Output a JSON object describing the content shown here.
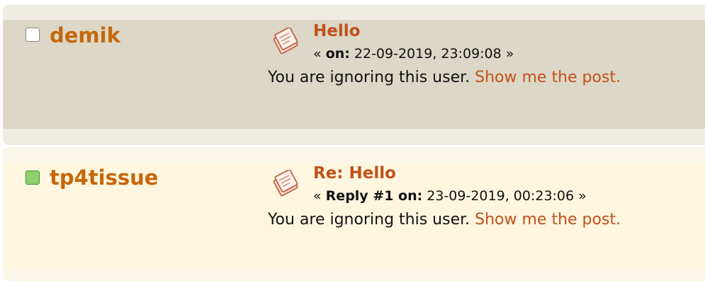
{
  "posts": [
    {
      "poster": "demik",
      "subject": "Hello",
      "meta_open": "« ",
      "meta_label": "on:",
      "meta_date": " 22-09-2019, 23:09:08 »",
      "notice": "You are ignoring this user. ",
      "show_link": "Show me the post.",
      "status": "offline"
    },
    {
      "poster": "tp4tissue",
      "subject": "Re: Hello",
      "meta_open": "« ",
      "meta_label": "Reply #1 on:",
      "meta_date": " 23-09-2019, 00:23:06 »",
      "notice": "You are ignoring this user. ",
      "show_link": "Show me the post.",
      "status": "online"
    }
  ],
  "icons": {
    "status": "status-indicator-icon",
    "topic": "xx-topic-icon"
  },
  "colors": {
    "name": "#c5670a",
    "link": "#c2511b",
    "online": "#8fd16d",
    "post1_band": "#dcd7c6",
    "post2_band": "#fef6df"
  }
}
